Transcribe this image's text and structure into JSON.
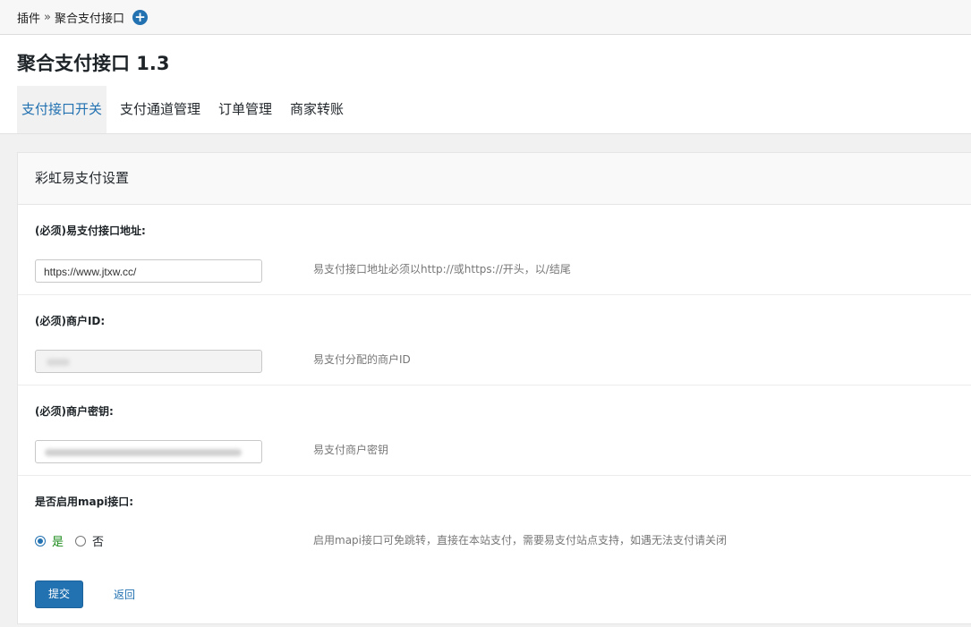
{
  "breadcrumb": {
    "parent": "插件",
    "separator": "»",
    "current": "聚合支付接口",
    "add_icon": "plus-circle-icon"
  },
  "page": {
    "title": "聚合支付接口 1.3"
  },
  "tabs": [
    {
      "label": "支付接口开关",
      "active": true
    },
    {
      "label": "支付通道管理",
      "active": false
    },
    {
      "label": "订单管理",
      "active": false
    },
    {
      "label": "商家转账",
      "active": false
    }
  ],
  "panel": {
    "title": "彩虹易支付设置",
    "fields": [
      {
        "label": "(必须)易支付接口地址:",
        "value": "https://www.jtxw.cc/",
        "hint": "易支付接口地址必须以http://或https://开头，以/结尾"
      },
      {
        "label": "(必须)商户ID:",
        "value": "",
        "hint": "易支付分配的商户ID"
      },
      {
        "label": "(必须)商户密钥:",
        "value": "",
        "hint": "易支付商户密钥"
      }
    ],
    "mapi": {
      "label": "是否启用mapi接口:",
      "options": [
        "是",
        "否"
      ],
      "selected": "是",
      "hint": "启用mapi接口可免跳转，直接在本站支付，需要易支付站点支持，如遇无法支付请关闭"
    },
    "actions": {
      "submit": "提交",
      "back": "返回"
    }
  },
  "colors": {
    "accent": "#2271b1",
    "yes_text": "#1a8a1a"
  }
}
